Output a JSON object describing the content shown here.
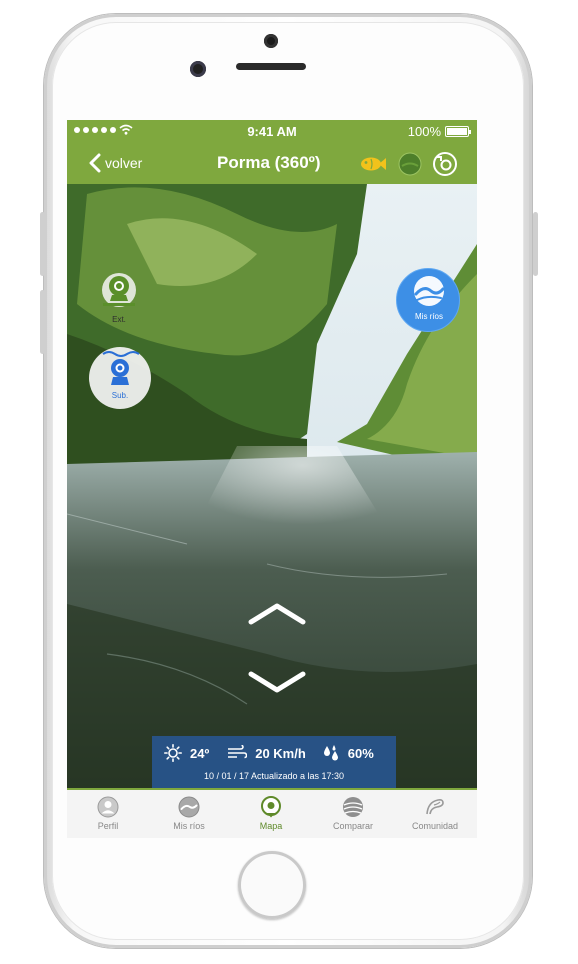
{
  "status_bar": {
    "time": "9:41 AM",
    "battery": "100%"
  },
  "nav": {
    "back_label": "volver",
    "title": "Porma (360º)"
  },
  "overlay_buttons": {
    "ext_label": "Ext.",
    "sub_label": "Sub.",
    "mis_rios_label": "Mis ríos"
  },
  "info": {
    "temperature": "24º",
    "wind": "20 Km/h",
    "humidity": "60%",
    "updated": "10 / 01 / 17  Actualizado a las 17:30"
  },
  "tabs": [
    {
      "label": "Perfil",
      "icon": "user-icon"
    },
    {
      "label": "Mis ríos",
      "icon": "river-icon"
    },
    {
      "label": "Mapa",
      "icon": "map-pin-icon",
      "active": true
    },
    {
      "label": "Comparar",
      "icon": "globe-icon"
    },
    {
      "label": "Comunidad",
      "icon": "community-icon"
    }
  ],
  "colors": {
    "brand_green": "#7fa83e",
    "blue": "#3d8fe6",
    "fish_yellow": "#f2c21b"
  }
}
